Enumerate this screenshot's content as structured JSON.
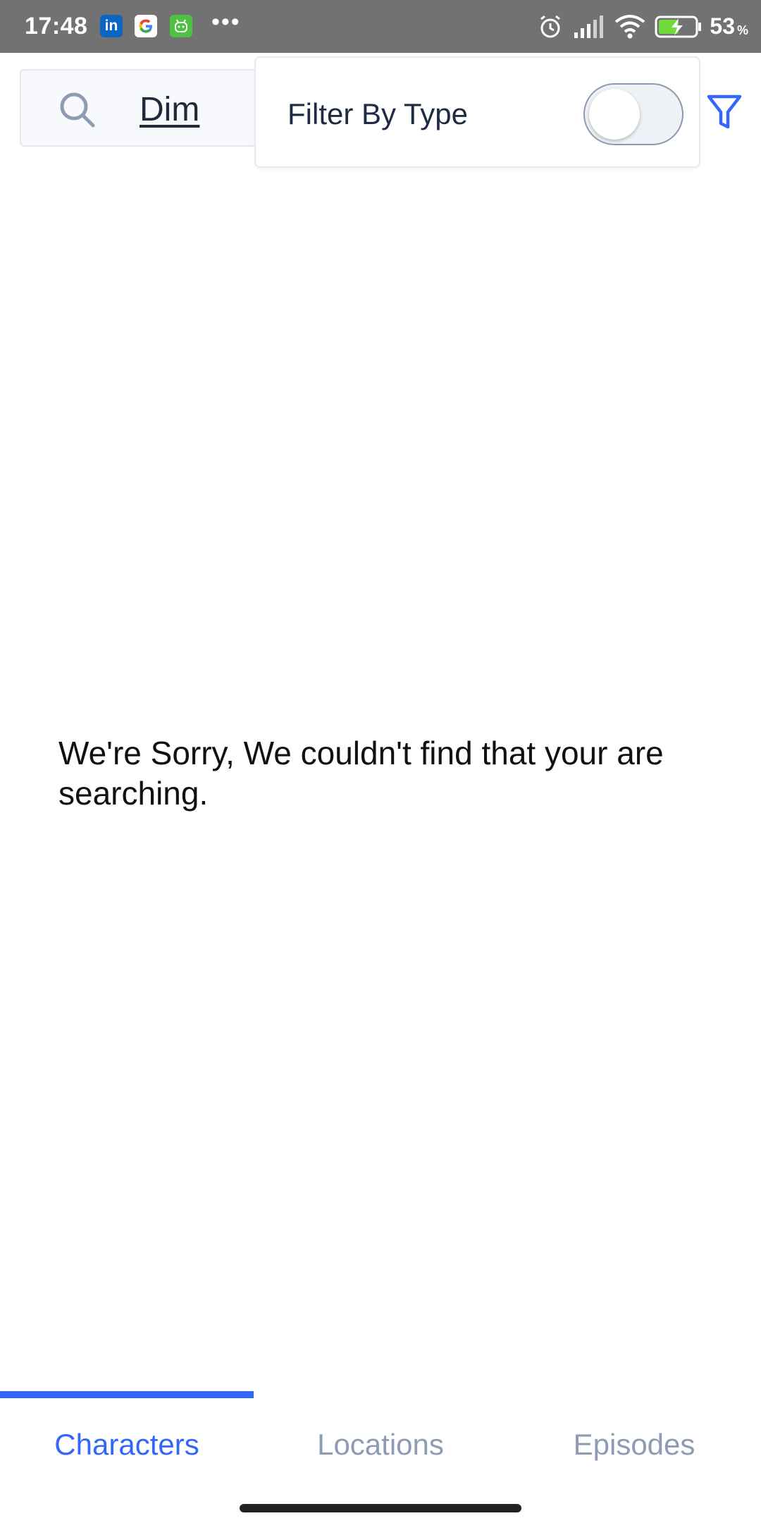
{
  "status_bar": {
    "time": "17:48",
    "app_icons": [
      "linkedin-icon",
      "google-icon",
      "android-icon"
    ],
    "more": "•••",
    "battery_level": "53",
    "battery_unit": "%"
  },
  "search": {
    "value": "Dim",
    "icon": "search-icon"
  },
  "filter": {
    "label": "Filter By Type",
    "toggle_on": false,
    "icon": "filter-icon"
  },
  "empty_state": {
    "message": "We're Sorry, We couldn't find that your are searching."
  },
  "tabs": [
    {
      "label": "Characters",
      "active": true
    },
    {
      "label": "Locations",
      "active": false
    },
    {
      "label": "Episodes",
      "active": false
    }
  ],
  "colors": {
    "accent": "#3366ff",
    "inactive_tab": "#8f9bb3",
    "status_bar": "#727272",
    "text_dark": "#1f2a44"
  }
}
